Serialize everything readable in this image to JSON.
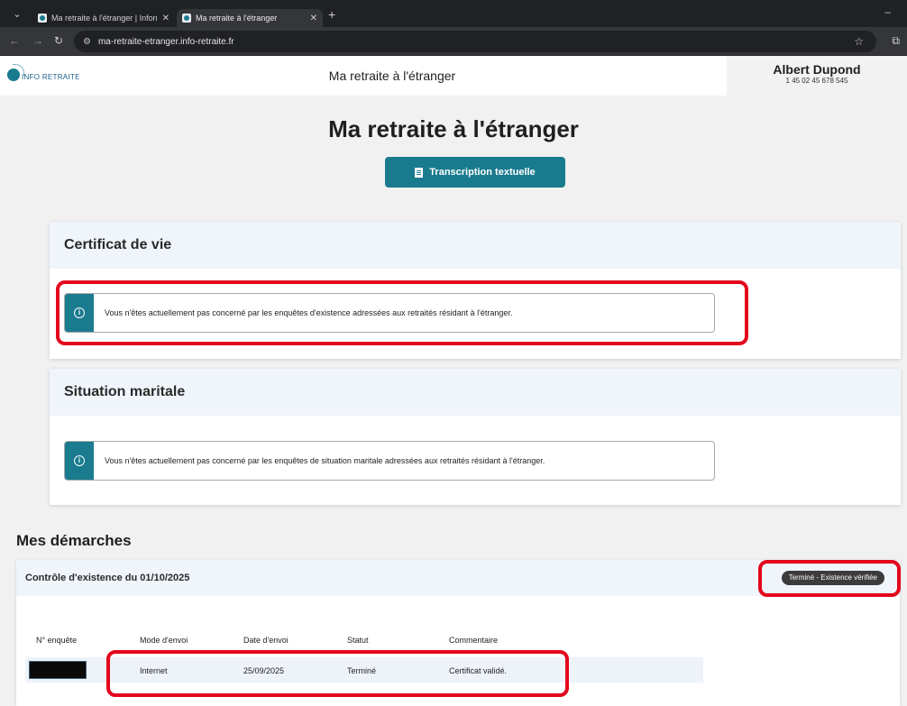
{
  "browser": {
    "tabs": [
      {
        "title": "Ma retraite à l'étranger | Inform"
      },
      {
        "title": "Ma retraite à l'étranger"
      }
    ],
    "url": "ma-retraite-etranger.info-retraite.fr"
  },
  "header": {
    "logo_text": "INFO RETRAITE",
    "title": "Ma retraite à l'étranger",
    "user_name": "Albert Dupond",
    "user_phone": "1 45 02 45 678 545"
  },
  "main": {
    "title": "Ma retraite à l'étranger",
    "transcript_button": "Transcription textuelle"
  },
  "certificat": {
    "title": "Certificat de vie",
    "notice": "Vous n'êtes actuellement pas concerné par les enquêtes d'existence adressées aux retraités résidant à l'étranger."
  },
  "maritale": {
    "title": "Situation maritale",
    "notice": "Vous n'êtes actuellement pas concerné par les enquêtes de situation maritale adressées aux retraités résidant à l'étranger."
  },
  "demarches": {
    "section_title": "Mes démarches",
    "card_title": "Contrôle d'existence du 01/10/2025",
    "status_badge": "Terminé - Existence vérifiée",
    "columns": [
      "N° enquête",
      "Mode d'envoi",
      "Date d'envoi",
      "Statut",
      "Commentaire"
    ],
    "row": {
      "mode": "Internet",
      "date": "25/09/2025",
      "statut": "Terminé",
      "commentaire": "Certificat validé."
    }
  },
  "colors": {
    "accent": "#1a7b8f",
    "highlight": "#e3061c",
    "card_header": "#f0f4fb"
  }
}
